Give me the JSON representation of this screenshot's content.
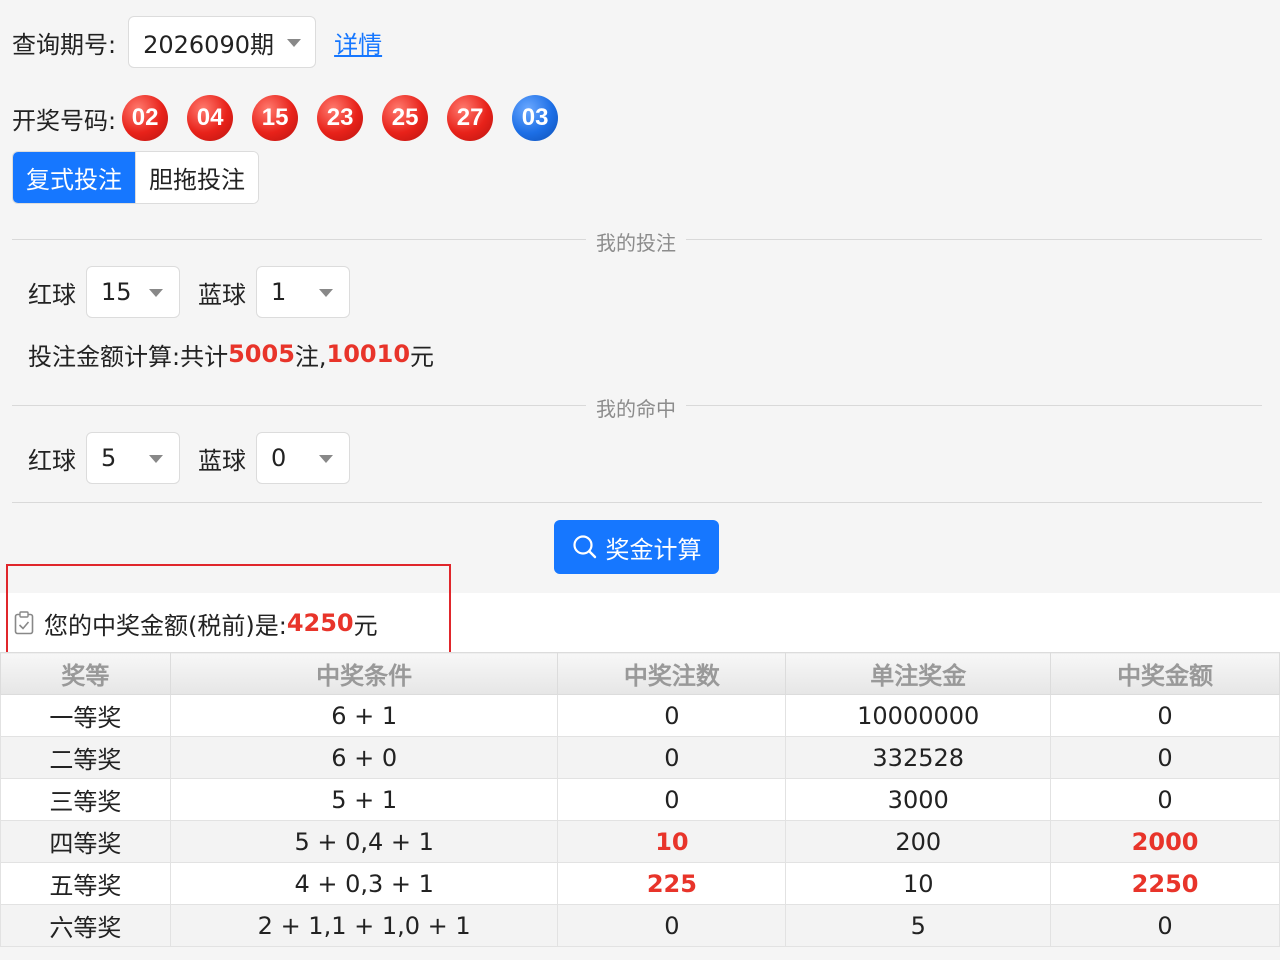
{
  "query": {
    "label": "查询期号:",
    "period": "2026090期",
    "details_link": "详情"
  },
  "draw": {
    "label": "开奖号码:",
    "red_balls": [
      "02",
      "04",
      "15",
      "23",
      "25",
      "27"
    ],
    "blue_balls": [
      "03"
    ],
    "colors": {
      "red": "#e8221a",
      "blue": "#1d6fe6"
    }
  },
  "tabs": [
    {
      "label": "复式投注",
      "active": true
    },
    {
      "label": "胆拖投注",
      "active": false
    }
  ],
  "my_bet": {
    "title": "我的投注",
    "red_label": "红球",
    "red_value": "15",
    "blue_label": "蓝球",
    "blue_value": "1",
    "amount_prefix": "投注金额计算:共计",
    "count": "5005",
    "count_suffix": "注,",
    "money": "10010",
    "money_suffix": "元"
  },
  "my_hit": {
    "title": "我的命中",
    "red_label": "红球",
    "red_value": "5",
    "blue_label": "蓝球",
    "blue_value": "0"
  },
  "calc_button": {
    "label": "奖金计算",
    "icon": "search-icon"
  },
  "result": {
    "icon": "clipboard-check-icon",
    "prefix": "您的中奖金额(税前)是:",
    "amount": "4250",
    "suffix": "元"
  },
  "prize_table": {
    "headers": [
      "奖等",
      "中奖条件",
      "中奖注数",
      "单注奖金",
      "中奖金额"
    ],
    "rows": [
      {
        "level": "一等奖",
        "condition": "6 + 1",
        "count": "0",
        "unit": "10000000",
        "total": "0",
        "win": false
      },
      {
        "level": "二等奖",
        "condition": "6 + 0",
        "count": "0",
        "unit": "332528",
        "total": "0",
        "win": false
      },
      {
        "level": "三等奖",
        "condition": "5 + 1",
        "count": "0",
        "unit": "3000",
        "total": "0",
        "win": false
      },
      {
        "level": "四等奖",
        "condition": "5 + 0,4 + 1",
        "count": "10",
        "unit": "200",
        "total": "2000",
        "win": true
      },
      {
        "level": "五等奖",
        "condition": "4 + 0,3 + 1",
        "count": "225",
        "unit": "10",
        "total": "2250",
        "win": true
      },
      {
        "level": "六等奖",
        "condition": "2 + 1,1 + 1,0 + 1",
        "count": "0",
        "unit": "5",
        "total": "0",
        "win": false
      }
    ]
  }
}
